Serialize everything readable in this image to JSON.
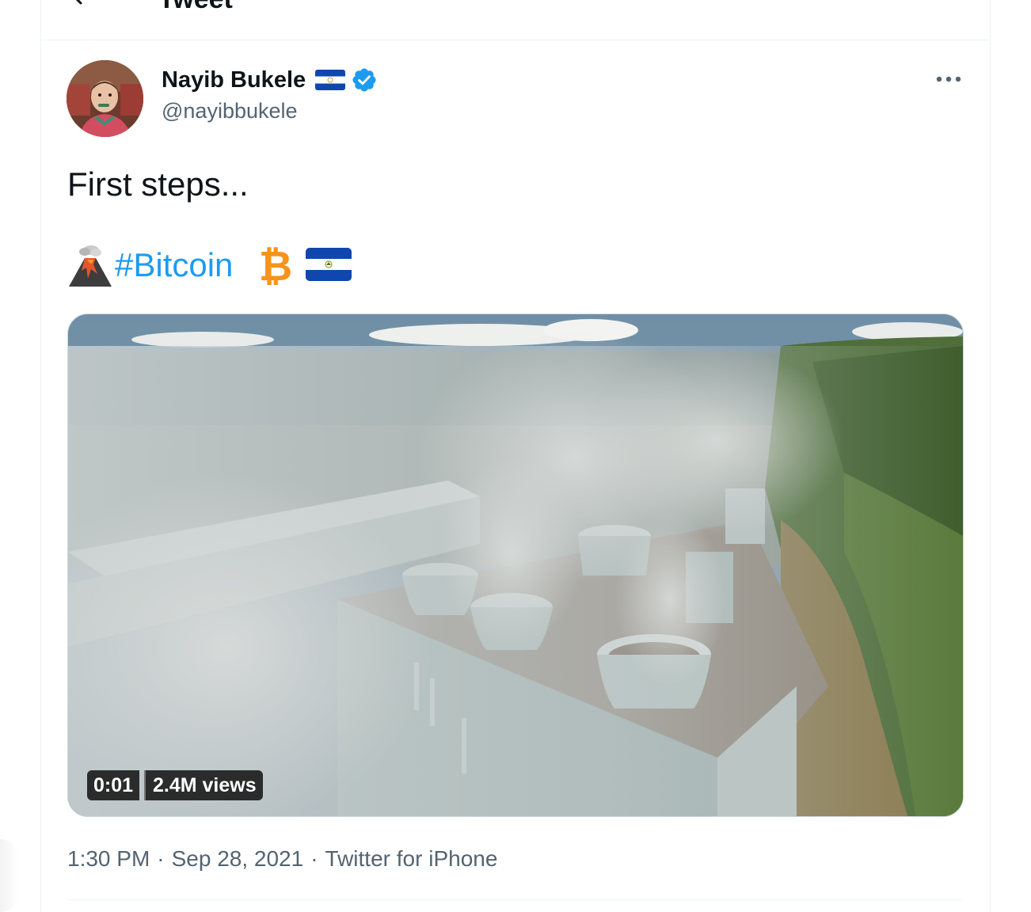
{
  "header": {
    "title": "Tweet"
  },
  "tweet": {
    "author_name": "Nayib Bukele",
    "author_handle": "@nayibbukele",
    "text_line1": "First steps...",
    "hashtag": "#Bitcoin",
    "video_time": "0:01",
    "video_views": "2.4M views",
    "time": "1:30 PM",
    "date": "Sep 28, 2021",
    "source": "Twitter for iPhone",
    "separator": "·"
  },
  "icons": {
    "back": "back-arrow-icon",
    "verified": "verified-badge-icon",
    "more": "more-options-icon",
    "flag": "el-salvador-flag-icon",
    "volcano": "volcano-emoji-icon",
    "bitcoin": "bitcoin-emoji-icon"
  },
  "colors": {
    "link": "#1d9bf0",
    "secondary_text": "#536471",
    "primary_text": "#0f1419",
    "border": "#eff3f4",
    "bitcoin_orange": "#f7931a",
    "flag_blue": "#0f47af"
  }
}
